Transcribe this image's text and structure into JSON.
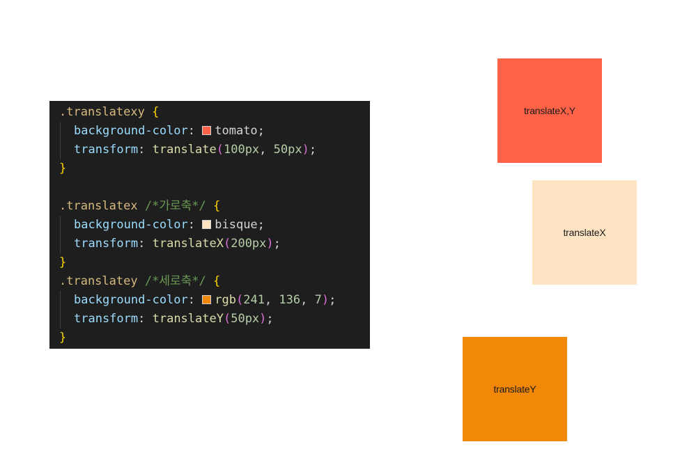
{
  "code": {
    "block1": {
      "selector": ".translatexy",
      "open_brace": "{",
      "prop1": "background-color",
      "colon1": ": ",
      "swatch1_color": "#ff6347",
      "value1": "tomato",
      "semi1": ";",
      "prop2": "transform",
      "colon2": ": ",
      "fn2": "translate",
      "paren_open2": "(",
      "arg2a": "100px",
      "comma2": ", ",
      "arg2b": "50px",
      "paren_close2": ")",
      "semi2": ";",
      "close_brace": "}"
    },
    "block2": {
      "selector": ".translatex",
      "comment": "/*가로축*/",
      "open_brace": "{",
      "prop1": "background-color",
      "colon1": ": ",
      "swatch1_color": "#ffe4c4",
      "value1": "bisque",
      "semi1": ";",
      "prop2": "transform",
      "colon2": ": ",
      "fn2": "translateX",
      "paren_open2": "(",
      "arg2a": "200px",
      "paren_close2": ")",
      "semi2": ";",
      "close_brace": "}"
    },
    "block3": {
      "selector": ".translatey",
      "comment": "/*세로축*/",
      "open_brace": "{",
      "prop1": "background-color",
      "colon1": ": ",
      "swatch1_color": "#f18807",
      "fn1": "rgb",
      "paren_open1": "(",
      "arg1a": "241",
      "comma1a": ", ",
      "arg1b": "136",
      "comma1b": ", ",
      "arg1c": "7",
      "paren_close1": ")",
      "semi1": ";",
      "prop2": "transform",
      "colon2": ": ",
      "fn2": "translateY",
      "paren_open2": "(",
      "arg2a": "50px",
      "paren_close2": ")",
      "semi2": ";",
      "close_brace": "}"
    }
  },
  "boxes": {
    "xy": {
      "label": "translateX,Y",
      "color": "#ff6347"
    },
    "x": {
      "label": "translateX",
      "color": "#ffe4c4"
    },
    "y": {
      "label": "translateY",
      "color": "#f18807"
    }
  },
  "colors": {
    "editor_background": "#1e1e1e"
  }
}
